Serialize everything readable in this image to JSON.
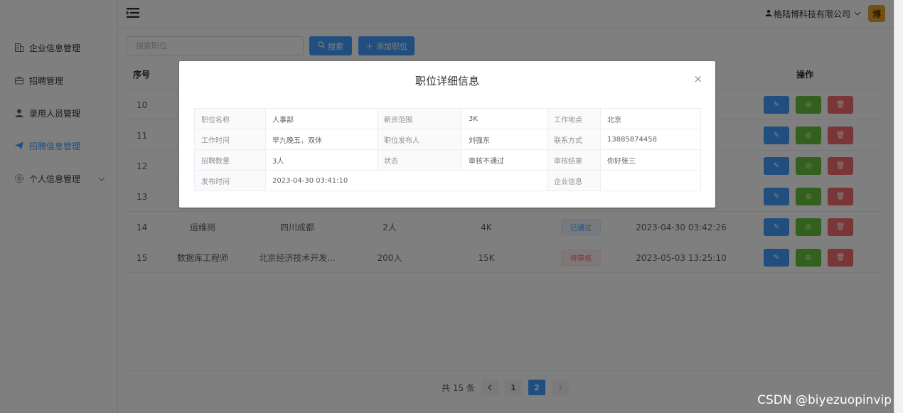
{
  "header": {
    "company": "格陆博科技有限公司",
    "avatar_text": "博"
  },
  "sidebar": {
    "items": [
      {
        "label": "企业信息管理"
      },
      {
        "label": "招聘管理"
      },
      {
        "label": "录用人员管理"
      },
      {
        "label": "招聘信息管理"
      },
      {
        "label": "个人信息管理"
      }
    ]
  },
  "toolbar": {
    "search_placeholder": "搜索职位",
    "search_label": "搜索",
    "add_label": "添加职位"
  },
  "table": {
    "header_index": "序号",
    "header_ops": "操作",
    "rows": [
      {
        "index": "10",
        "name": "",
        "location": "",
        "count": "",
        "salary": "",
        "status": "",
        "time": ""
      },
      {
        "index": "11",
        "name": "",
        "location": "",
        "count": "",
        "salary": "",
        "status": "",
        "time": ""
      },
      {
        "index": "12",
        "name": "",
        "location": "",
        "count": "",
        "salary": "",
        "status": "",
        "time": ""
      },
      {
        "index": "13",
        "name": "",
        "location": "",
        "count": "",
        "salary": "",
        "status": "",
        "time": ""
      },
      {
        "index": "14",
        "name": "运维岗",
        "location": "四川成都",
        "count": "2人",
        "salary": "4K",
        "status": "已通过",
        "time": "2023-04-30 03:42:26"
      },
      {
        "index": "15",
        "name": "数据库工程师",
        "location": "北京经济技术开发...",
        "count": "200人",
        "salary": "15K",
        "status": "待审核",
        "time": "2023-05-03 13:25:10"
      }
    ]
  },
  "pagination": {
    "total_text": "共 15 条",
    "pages": [
      "1",
      "2"
    ],
    "current": "2"
  },
  "dialog": {
    "title": "职位详细信息",
    "close": "×",
    "fields": {
      "name_label": "职位名称",
      "name_value": "人事部",
      "salary_label": "薪资范围",
      "salary_value": "3K",
      "location_label": "工作地点",
      "location_value": "北京",
      "worktime_label": "工作时间",
      "worktime_value": "早九晚五，双休",
      "publisher_label": "职位发布人",
      "publisher_value": "刘强东",
      "contact_label": "联系方式",
      "contact_value": "13885874458",
      "count_label": "招聘数量",
      "count_value": "3人",
      "status_label": "状态",
      "status_value": "审核不通过",
      "result_label": "审核结果",
      "result_value": "你好张三",
      "pubtime_label": "发布时间",
      "pubtime_value": "2023-04-30 03:41:10",
      "company_label": "企业信息",
      "company_value": ""
    }
  },
  "watermark": "CSDN @biyezuopinvip",
  "colors": {
    "primary": "#409eff",
    "success": "#67c23a",
    "danger": "#f56c6c"
  },
  "icons": [
    "building-icon",
    "briefcase-icon",
    "user-icon",
    "send-icon",
    "settings-icon",
    "hamburger-icon",
    "search-icon",
    "plus-icon",
    "edit-icon",
    "view-icon",
    "delete-icon",
    "chevron-down-icon",
    "close-icon"
  ]
}
